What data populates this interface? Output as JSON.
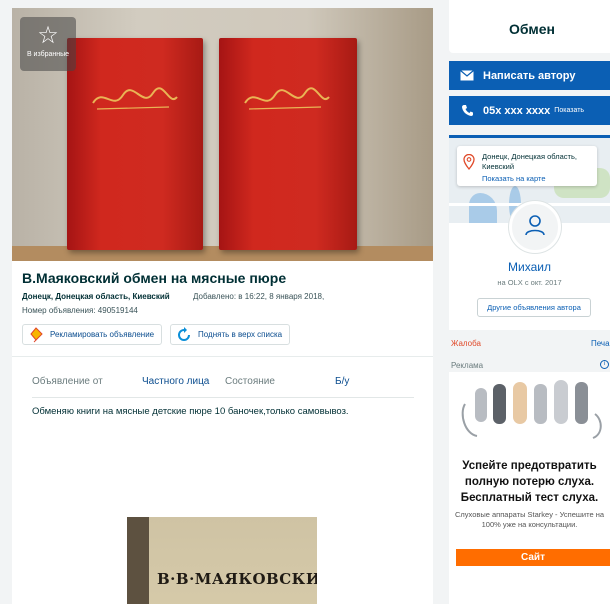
{
  "listing": {
    "favorite_label": "В избранные",
    "title": "В.Маяковский обмен на мясные пюре",
    "location": "Донецк, Донецкая область, Киевский",
    "added": "Добавлено: в 16:22, 8 января 2018,",
    "ad_number": "Номер объявления: 490519144",
    "promote_label": "Рекламировать объявление",
    "raise_label": "Поднять в верх списка",
    "params": {
      "k1": "Объявление от",
      "v1": "Частного лица",
      "k2": "Состояние",
      "v2": "Б/у"
    },
    "description": "Обменяю книги на мясные детские пюре 10 баночек,только самовывоз.",
    "photo2_caption": "В·В·МАЯКОВСКИЙ"
  },
  "sidebar": {
    "price": "Обмен",
    "write_label": "Написать автору",
    "phone": "05x xxx xxxx",
    "phone_show": "Показать",
    "address": "Донецк, Донецкая область, Киевский",
    "show_map": "Показать на карте",
    "user_name": "Михаил",
    "user_since": "на OLX с окт. 2017",
    "other_ads": "Другие объявления автора",
    "complain": "Жалоба",
    "print": "Печа"
  },
  "advert": {
    "label": "Реклама",
    "info": "i",
    "headline_1": "Успейте предотвратить",
    "headline_2": "полную потерю слуха.",
    "headline_3": "Бесплатный тест слуха.",
    "sub_1": "Слуховые аппараты Starkey - Успешите на",
    "sub_2": "100% уже на консультации.",
    "button": "Сайт"
  },
  "colors": {
    "accent": "#0b5fb4",
    "ad_button": "#ff6d00",
    "complain": "#e04a2a"
  },
  "icons": [
    "star-icon",
    "envelope-icon",
    "phone-icon",
    "map-pin-icon",
    "user-icon",
    "kite-icon",
    "refresh-icon",
    "info-icon"
  ]
}
